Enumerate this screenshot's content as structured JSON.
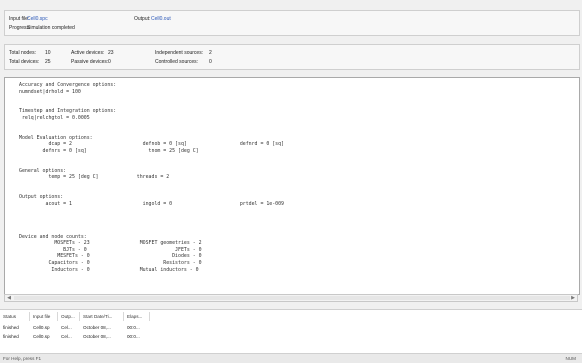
{
  "header": {
    "input_file_label": "Input file:",
    "input_file_value": "Cell0.spc",
    "output_label": "Output:",
    "output_value": "Cell0.out",
    "progress_label": "Progress:",
    "progress_value": "Simulation completed"
  },
  "stats": {
    "total_nodes_label": "Total nodes:",
    "total_nodes_value": "10",
    "active_devices_label": "Active devices:",
    "active_devices_value": "23",
    "independent_sources_label": "Independent sources:",
    "independent_sources_value": "2",
    "total_devices_label": "Total devices:",
    "total_devices_value": "25",
    "passive_devices_label": "Passive devices:",
    "passive_devices_value": "0",
    "controlled_sources_label": "Controlled sources:",
    "controlled_sources_value": "0"
  },
  "output_text": "Accuracy and Convergence options:\nnumndset|drhold = 100\n\n\nTimestep and Integration options:\n relq|relchgtol = 0.0005\n\n\nModel Evaluation options:\n          dcap = 2                        defnob = 0 [sq]                  defnrd = 0 [sq]\n        defnrs = 0 [sq]                     tnom = 25 [deg C]\n\n\nGeneral options:\n          temp = 25 [deg C]             threads = 2\n\n\nOutput options:\n         acout = 1                        ingold = 0                       prtdel = 1e-009\n\n\n\n\nDevice and node counts:\n            MOSFETs - 23                 MOSFET geometries - 2\n               BJTs - 0                              JFETs - 0\n             MESFETs - 0                            Diodes - 0\n          Capacitors - 0                         Resistors - 0\n           Inductors - 0                 Mutual inductors - 0",
  "jobs": {
    "columns": [
      "Status",
      "Input file",
      "Outp...",
      "Start Date/Ti...",
      "Elaps..."
    ],
    "rows": [
      [
        "finished",
        "Cell0.sp",
        "Cel...",
        "October 08,...",
        "00:0..."
      ],
      [
        "finished",
        "Cell0.sp",
        "Cel...",
        "October 08,...",
        "00:0..."
      ]
    ]
  },
  "statusbar": {
    "left": "For Help, press F1",
    "right": "NUM"
  }
}
